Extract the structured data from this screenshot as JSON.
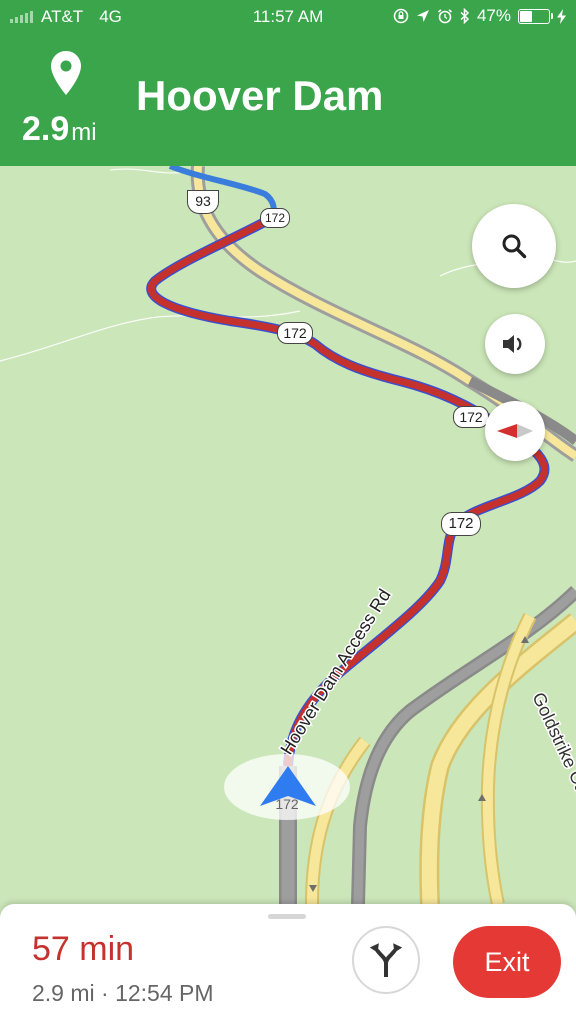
{
  "status_bar": {
    "carrier": "AT&T",
    "network": "4G",
    "time": "11:57 AM",
    "battery": "47%",
    "battery_level": 0.47
  },
  "navigation": {
    "distance_value": "2.9",
    "distance_unit": "mi",
    "destination": "Hoover Dam"
  },
  "map": {
    "shields": {
      "us93": "93",
      "sr172_top": "172",
      "sr172_mid": "172",
      "sr172_right": "172",
      "sr172_lower": "172",
      "sr172_car": "172"
    },
    "road_labels": {
      "access_rd": "Hoover Dam Access Rd",
      "goldstrike": "Goldstrike Canyon Rd"
    },
    "controls": {
      "search": "search-icon",
      "volume": "volume-icon",
      "compass": "compass-icon"
    }
  },
  "trip": {
    "duration": "57 min",
    "distance_arrival": "2.9 mi · 12:54 PM",
    "exit_label": "Exit"
  },
  "colors": {
    "header_green": "#3aa54b",
    "traffic_red": "#c5312c",
    "exit_red": "#e53935",
    "map_green": "#cbe6b8"
  }
}
